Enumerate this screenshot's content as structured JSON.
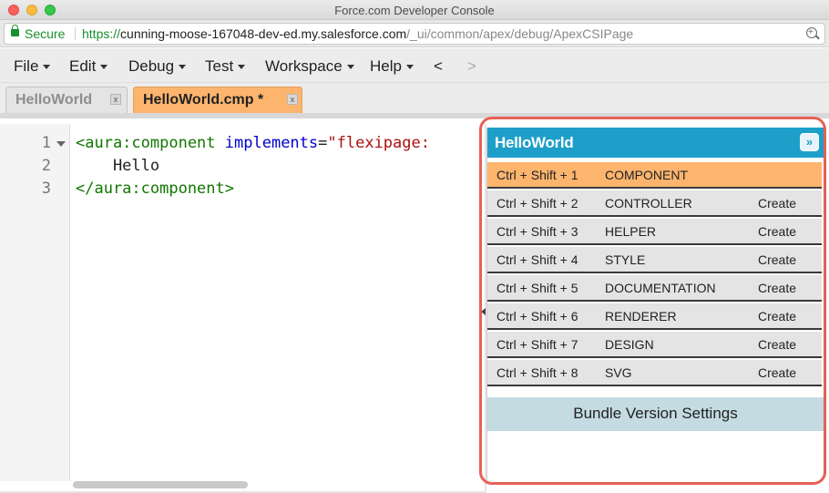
{
  "window": {
    "title": "Force.com Developer Console"
  },
  "address_bar": {
    "secure_label": "Secure",
    "url_scheme": "https://",
    "url_host": "cunning-moose-167048-dev-ed.my.salesforce.com",
    "url_path": "/_ui/common/apex/debug/ApexCSIPage"
  },
  "menu": {
    "file": "File",
    "edit": "Edit",
    "debug": "Debug",
    "test": "Test",
    "workspace": "Workspace",
    "help": "Help",
    "back": "<",
    "forward": ">"
  },
  "tabs": [
    {
      "label": "HelloWorld",
      "active": false,
      "close": "x"
    },
    {
      "label": "HelloWorld.cmp *",
      "active": true,
      "close": "x"
    }
  ],
  "editor": {
    "line_numbers": [
      "1",
      "2",
      "3"
    ],
    "line1": {
      "tag_open": "<aura:component",
      "space": " ",
      "attr": "implements",
      "eq": "=",
      "str": "\"flexipage:"
    },
    "line2": {
      "text": "    Hello"
    },
    "line3": {
      "tag_close": "</aura:component>"
    }
  },
  "bundle_panel": {
    "title": "HelloWorld",
    "collapse_icon": "»",
    "rows": [
      {
        "shortcut": "Ctrl + Shift + 1",
        "name": "COMPONENT",
        "action": ""
      },
      {
        "shortcut": "Ctrl + Shift + 2",
        "name": "CONTROLLER",
        "action": "Create"
      },
      {
        "shortcut": "Ctrl + Shift + 3",
        "name": "HELPER",
        "action": "Create"
      },
      {
        "shortcut": "Ctrl + Shift + 4",
        "name": "STYLE",
        "action": "Create"
      },
      {
        "shortcut": "Ctrl + Shift + 5",
        "name": "DOCUMENTATION",
        "action": "Create"
      },
      {
        "shortcut": "Ctrl + Shift + 6",
        "name": "RENDERER",
        "action": "Create"
      },
      {
        "shortcut": "Ctrl + Shift + 7",
        "name": "DESIGN",
        "action": "Create"
      },
      {
        "shortcut": "Ctrl + Shift + 8",
        "name": "SVG",
        "action": "Create"
      }
    ],
    "settings_button": "Bundle Version Settings"
  },
  "colors": {
    "panel_header": "#1e9fc9",
    "active_tab": "#fdb56e",
    "highlight_border": "#e46157",
    "secure_green": "#1a8f2f"
  }
}
